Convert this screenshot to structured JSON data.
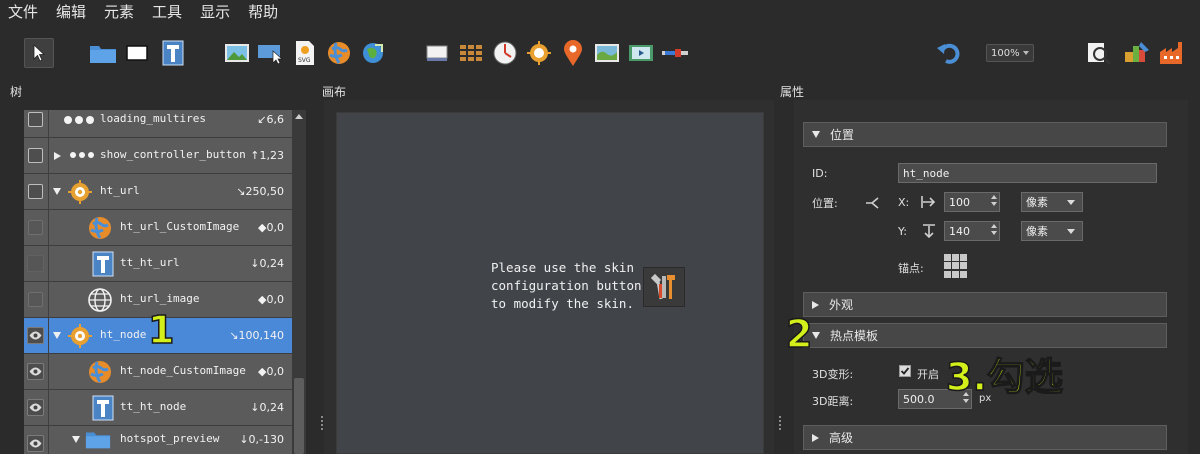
{
  "menu": [
    "文件",
    "编辑",
    "元素",
    "工具",
    "显示",
    "帮助"
  ],
  "toolbar": {
    "zoom_value": "100%",
    "tools": [
      "pointer-icon",
      "folder-icon",
      "rectangle-icon",
      "text-icon",
      "image-icon",
      "image-pointer-icon",
      "svg-icon",
      "globe-icon",
      "globe-arrow-icon",
      "display-icon",
      "grid-icon",
      "compass-icon",
      "target-icon",
      "map-pin-icon",
      "map-icon",
      "video-icon",
      "slider-icon",
      "undo-icon",
      "preview-icon",
      "brush-icon",
      "factory-icon"
    ]
  },
  "panels": {
    "tree_title": "树",
    "canvas_title": "画布",
    "props_title": "属性"
  },
  "tree": {
    "rows": [
      {
        "name": "loading_multires",
        "coord": "↙6,6"
      },
      {
        "name": "show_controller_button",
        "coord": "↑1,23"
      },
      {
        "name": "ht_url",
        "coord": "↘250,50"
      },
      {
        "name": "ht_url_CustomImage",
        "coord": "◆0,0"
      },
      {
        "name": "tt_ht_url",
        "coord": "↓0,24"
      },
      {
        "name": "ht_url_image",
        "coord": "◆0,0"
      },
      {
        "name": "ht_node",
        "coord": "↘100,140"
      },
      {
        "name": "ht_node_CustomImage",
        "coord": "◆0,0"
      },
      {
        "name": "tt_ht_node",
        "coord": "↓0,24"
      },
      {
        "name": "hotspot_preview",
        "coord": "↓0,-130"
      }
    ]
  },
  "canvas": {
    "message": "Please use the skin\nconfiguration button\nto modify the skin."
  },
  "props": {
    "sections": {
      "position": "位置",
      "appearance": "外观",
      "hotspot_template": "热点模板",
      "advanced": "高级"
    },
    "id_label": "ID:",
    "id_value": "ht_node",
    "position_label": "位置:",
    "x_label": "X:",
    "x_value": "100",
    "y_label": "Y:",
    "y_value": "140",
    "unit_x": "像素",
    "unit_y": "像素",
    "anchor_label": "锚点:",
    "transform_label": "3D变形:",
    "transform_checkbox": "开启",
    "distance_label": "3D距离:",
    "distance_value": "500.0",
    "distance_unit": "px"
  },
  "annotations": {
    "a1": "1",
    "a2": "2",
    "a3": "3.勾选"
  },
  "colors": {
    "selected_row": "#4a88d8",
    "annotation": "#d4f01a"
  }
}
